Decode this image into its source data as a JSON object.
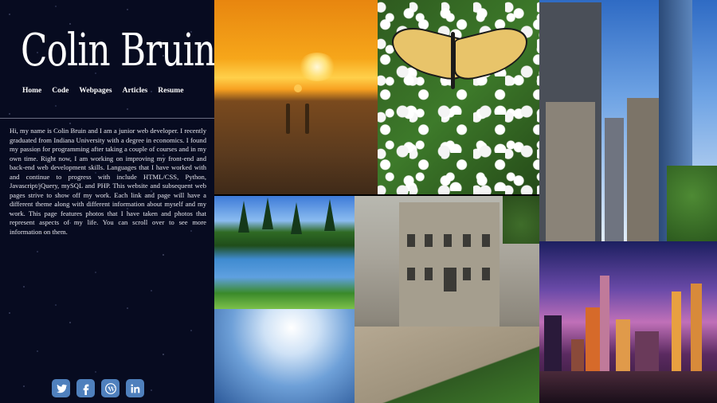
{
  "site": {
    "logo_text": "Colin Bruin"
  },
  "nav": {
    "items": [
      "Home",
      "Code",
      "Webpages",
      "Articles",
      "Resume"
    ]
  },
  "bio": {
    "text": "Hi, my name is Colin Bruin and I am a junior web developer. I recently graduated from Indiana University with a degree in economics. I found my passion for programming after taking a couple of courses and in my own time. Right now, I am working on improving my front-end and back-end web development skills. Languages that I have worked with and continue to progress with include HTML/CSS, Python, Javascript/jQuery, mySQL and PHP. This website and subsequent web pages strive to show off my work. Each link and page will have a different theme along with different information about myself and my work. This page features photos that I have taken and photos that represent aspects of my life. You can scroll over to see more information on them."
  },
  "social": {
    "icons": [
      "twitter-icon",
      "facebook-icon",
      "wordpress-icon",
      "linkedin-icon"
    ],
    "color": "#4f80bd"
  },
  "colors": {
    "sidebar_bg": "#070b20",
    "text": "#e6e6ee"
  }
}
